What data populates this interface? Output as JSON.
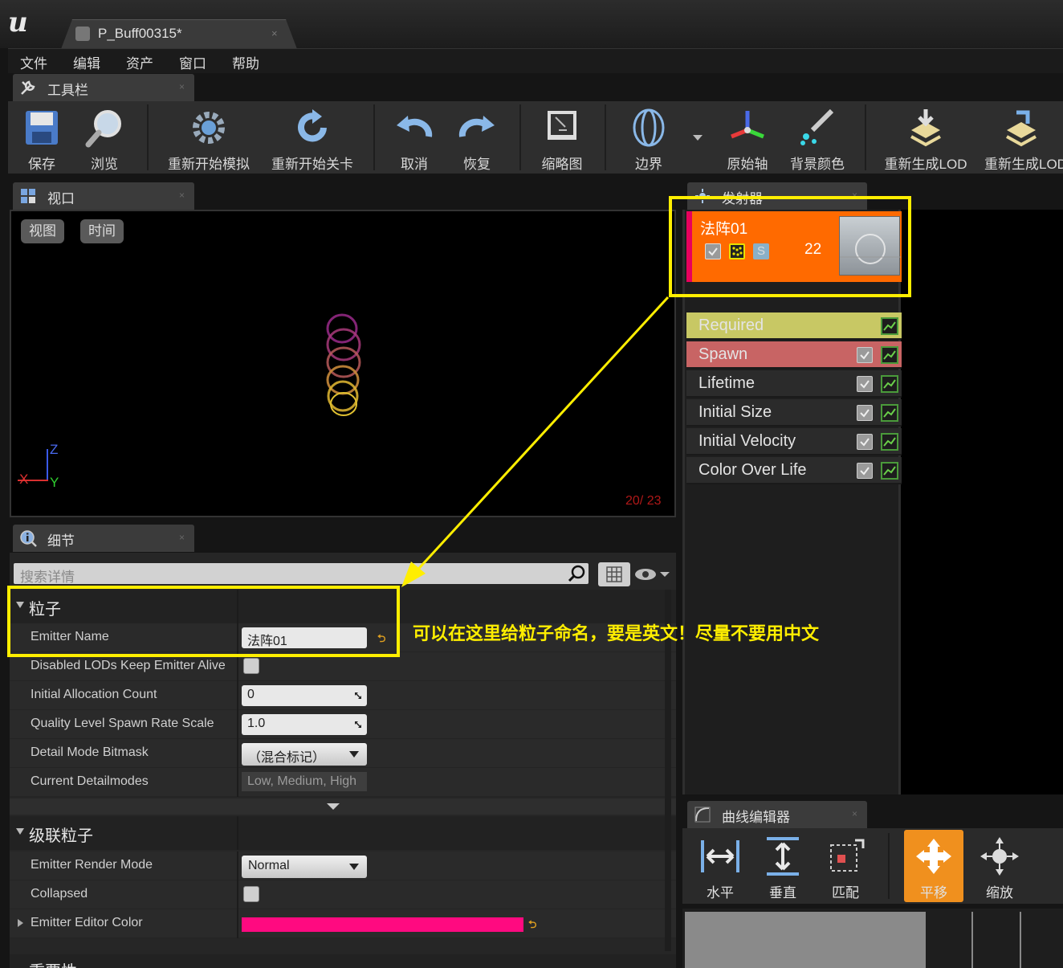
{
  "window": {
    "tab_title": "P_Buff00315*",
    "tab_close": "×"
  },
  "menu": [
    "文件",
    "编辑",
    "资产",
    "窗口",
    "帮助"
  ],
  "toolbar_panel": {
    "tab_label": "工具栏",
    "buttons": [
      "保存",
      "浏览",
      "重新开始模拟",
      "重新开始关卡",
      "取消",
      "恢复",
      "缩略图",
      "边界",
      "原始轴",
      "背景颜色",
      "重新生成LOD",
      "重新生成LOD"
    ]
  },
  "viewport_panel": {
    "tab_label": "视口",
    "view_button": "视图",
    "time_button": "时间",
    "axis_z": "Z",
    "axis_x": "X",
    "axis_y": "Y",
    "stats": "20/ 23"
  },
  "details_panel": {
    "tab_label": "细节",
    "search_placeholder": "搜索详情",
    "particles_section": {
      "title": "粒子",
      "rows": [
        {
          "label": "Emitter Name",
          "value": "法阵01"
        },
        {
          "label": "Disabled LODs Keep Emitter Alive"
        },
        {
          "label": "Initial Allocation Count",
          "value": "0"
        },
        {
          "label": "Quality Level Spawn Rate Scale",
          "value": "1.0"
        },
        {
          "label": "Detail Mode Bitmask",
          "value": "（混合标记）"
        },
        {
          "label": "Current Detailmodes",
          "value": "Low, Medium, High"
        }
      ]
    },
    "cascade_section": {
      "title": "级联粒子",
      "rows": [
        {
          "label": "Emitter Render Mode",
          "value": "Normal"
        },
        {
          "label": "Collapsed"
        },
        {
          "label": "Emitter Editor Color",
          "color": "#ff0a80"
        }
      ]
    },
    "next_section_title": "重要性"
  },
  "emitter_panel": {
    "tab_label": "发射器",
    "emitter_name": "法阵01",
    "particle_count": "22",
    "lod_badge": "S",
    "modules": [
      {
        "name": "Required",
        "color": "#c8c864",
        "has_checkbox": false
      },
      {
        "name": "Spawn",
        "color": "#c86464",
        "has_checkbox": true
      },
      {
        "name": "Lifetime",
        "color": "#2b2b2b",
        "has_checkbox": true
      },
      {
        "name": "Initial Size",
        "color": "#2b2b2b",
        "has_checkbox": true
      },
      {
        "name": "Initial Velocity",
        "color": "#2b2b2b",
        "has_checkbox": true
      },
      {
        "name": "Color Over Life",
        "color": "#2b2b2b",
        "has_checkbox": true
      }
    ]
  },
  "curve_panel": {
    "tab_label": "曲线编辑器",
    "buttons": [
      "水平",
      "垂直",
      "匹配",
      "平移",
      "缩放"
    ],
    "active_button": "平移"
  },
  "annotation": {
    "text": "可以在这里给粒子命名，要是英文！尽量不要用中文",
    "color": "#ffee00"
  }
}
